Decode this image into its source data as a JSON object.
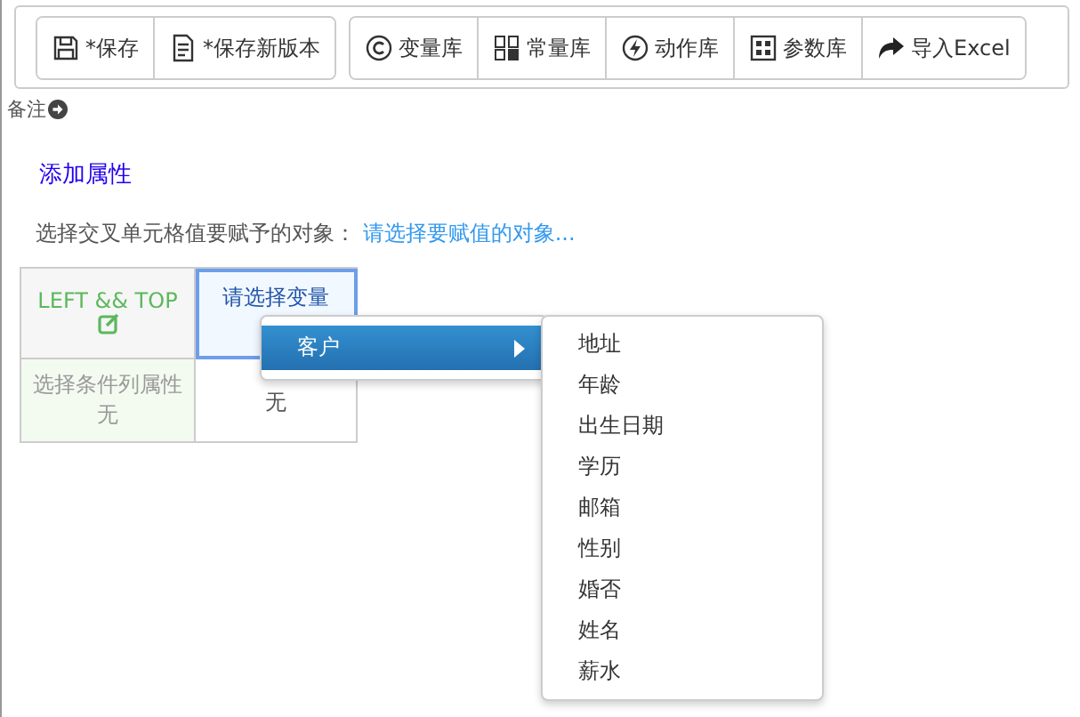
{
  "toolbar": {
    "groups": [
      {
        "buttons": [
          {
            "label": "*保存"
          },
          {
            "label": "*保存新版本"
          }
        ]
      },
      {
        "buttons": [
          {
            "label": "变量库"
          },
          {
            "label": "常量库"
          },
          {
            "label": "动作库"
          },
          {
            "label": "参数库"
          },
          {
            "label": "导入Excel"
          }
        ]
      }
    ]
  },
  "remark": {
    "label": "备注"
  },
  "add_property": "添加属性",
  "target": {
    "label": "选择交叉单元格值要赋予的对象：",
    "link": "请选择要赋值的对象..."
  },
  "table": {
    "corner": "LEFT && TOP",
    "column_header": {
      "text": "请选择变量",
      "selected": true
    },
    "row_header": {
      "label": "选择条件列属性",
      "value": "无"
    },
    "cell": "无"
  },
  "menu": {
    "items": [
      {
        "label": "客户",
        "selected": true,
        "has_submenu": true
      }
    ],
    "submenu": [
      {
        "label": "地址",
        "selected": false
      },
      {
        "label": "年龄",
        "selected": false
      },
      {
        "label": "出生日期",
        "selected": false
      },
      {
        "label": "学历",
        "selected": false
      },
      {
        "label": "邮箱",
        "selected": false
      },
      {
        "label": "性别",
        "selected": false
      },
      {
        "label": "婚否",
        "selected": false
      },
      {
        "label": "姓名",
        "selected": false
      },
      {
        "label": "薪水",
        "selected": false
      }
    ]
  }
}
